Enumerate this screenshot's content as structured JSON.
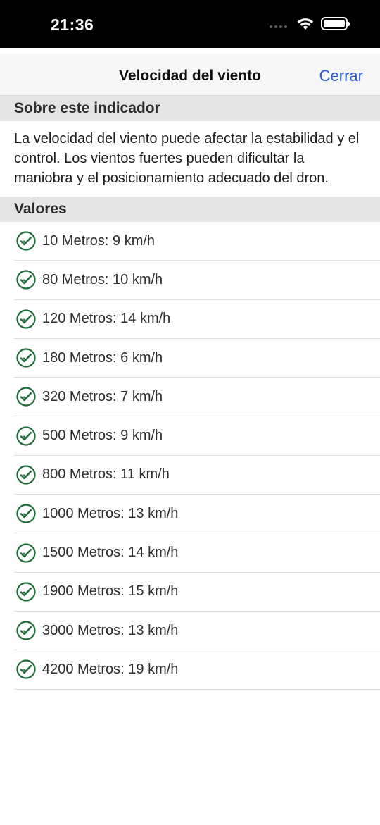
{
  "status_bar": {
    "time": "21:36"
  },
  "nav": {
    "title": "Velocidad del viento",
    "close_label": "Cerrar"
  },
  "about": {
    "header": "Sobre este indicador",
    "text": "La velocidad del viento puede afectar la estabilidad y el control. Los vientos fuertes pueden dificultar la maniobra y el posicionamiento adecuado del dron."
  },
  "values": {
    "header": "Valores",
    "items": [
      {
        "label": "10 Metros: 9 km/h",
        "icon": "check-circle-icon"
      },
      {
        "label": "80 Metros: 10 km/h",
        "icon": "check-circle-icon"
      },
      {
        "label": "120 Metros: 14 km/h",
        "icon": "check-circle-icon"
      },
      {
        "label": "180 Metros: 6 km/h",
        "icon": "check-circle-icon"
      },
      {
        "label": "320 Metros: 7 km/h",
        "icon": "check-circle-icon"
      },
      {
        "label": "500 Metros: 9 km/h",
        "icon": "check-circle-icon"
      },
      {
        "label": "800 Metros: 11 km/h",
        "icon": "check-circle-icon"
      },
      {
        "label": "1000 Metros: 13 km/h",
        "icon": "check-circle-icon"
      },
      {
        "label": "1500 Metros: 14 km/h",
        "icon": "check-circle-icon"
      },
      {
        "label": "1900 Metros: 15 km/h",
        "icon": "check-circle-icon"
      },
      {
        "label": "3000 Metros: 13 km/h",
        "icon": "check-circle-icon"
      },
      {
        "label": "4200 Metros: 19 km/h",
        "icon": "check-circle-icon"
      }
    ]
  },
  "colors": {
    "accent": "#2a5bd7",
    "check": "#1f6b3a",
    "section_bg": "#e5e5e5"
  }
}
